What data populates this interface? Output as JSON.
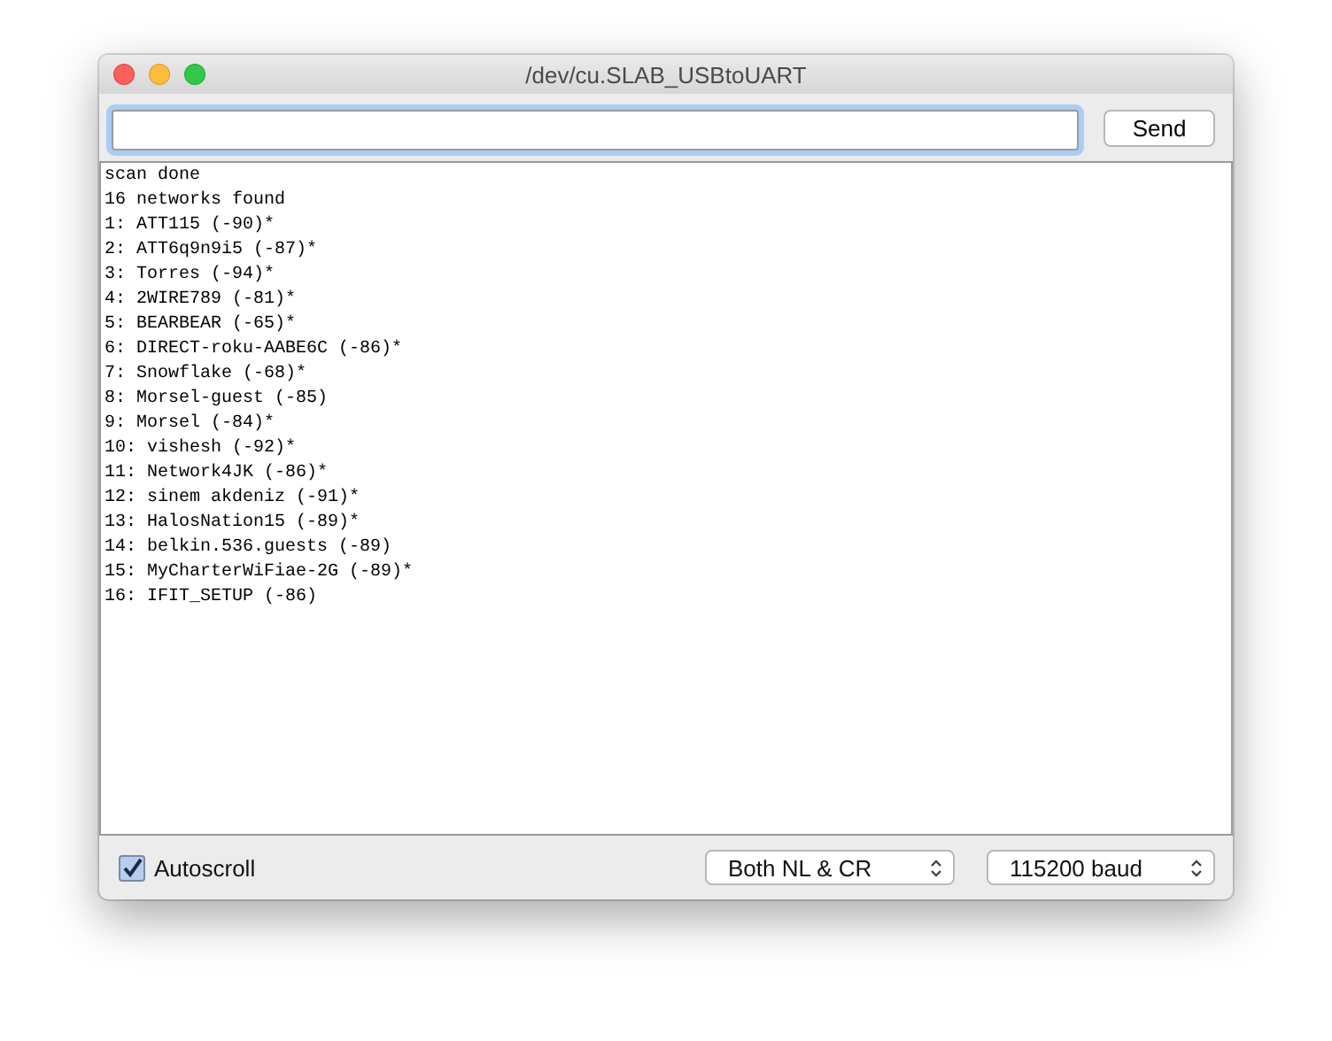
{
  "window": {
    "title": "/dev/cu.SLAB_USBtoUART"
  },
  "send_button": {
    "label": "Send"
  },
  "output_lines": [
    "scan done",
    "16 networks found",
    "1: ATT115 (-90)*",
    "2: ATT6q9n9i5 (-87)*",
    "3: Torres (-94)*",
    "4: 2WIRE789 (-81)*",
    "5: BEARBEAR (-65)*",
    "6: DIRECT-roku-AABE6C (-86)*",
    "7: Snowflake (-68)*",
    "8: Morsel-guest (-85)",
    "9: Morsel (-84)*",
    "10: vishesh (-92)*",
    "11: Network4JK (-86)*",
    "12: sinem akdeniz (-91)*",
    "13: HalosNation15 (-89)*",
    "14: belkin.536.guests (-89)",
    "15: MyCharterWiFiae-2G (-89)*",
    "16: IFIT_SETUP (-86)"
  ],
  "autoscroll": {
    "label": "Autoscroll",
    "checked": true
  },
  "line_ending": {
    "value": "Both NL & CR"
  },
  "baud_rate": {
    "value": "115200 baud"
  }
}
